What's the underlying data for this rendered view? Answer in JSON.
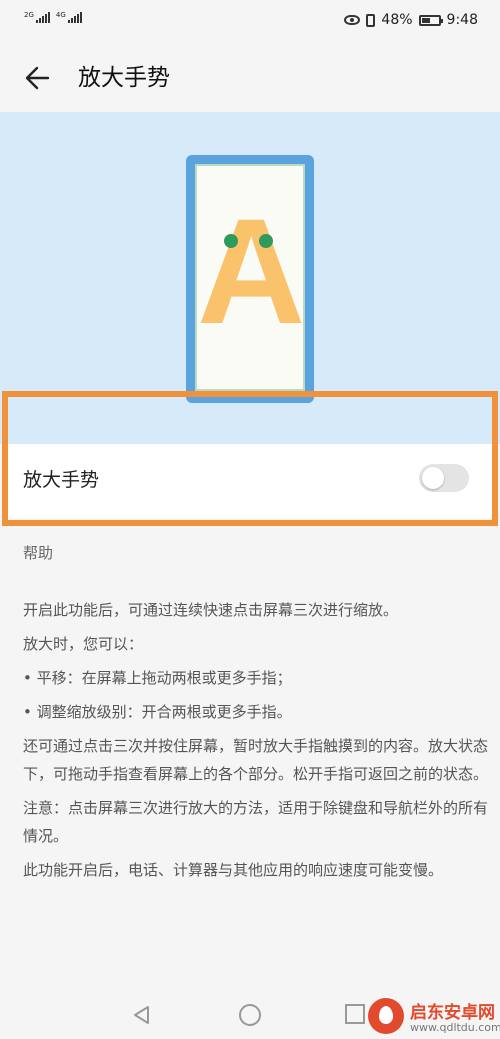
{
  "status_bar": {
    "sim1_network": "2G",
    "sim2_network": "4G",
    "battery_percent": "48%",
    "time": "9:48",
    "icons": [
      "eye-comfort-icon",
      "vibrate-icon",
      "battery-icon"
    ]
  },
  "header": {
    "title": "放大手势",
    "back_icon": "arrow-left-icon"
  },
  "illustration": {
    "letter": "A",
    "colors": {
      "background": "#d6eaf9",
      "phone_frame": "#5aa3de",
      "letter": "#f9c26b",
      "finger_dots": "#2e9b5c"
    }
  },
  "setting": {
    "label": "放大手势",
    "enabled": false
  },
  "highlight": {
    "color": "#f0923c"
  },
  "help": {
    "title": "帮助",
    "paragraphs": [
      "开启此功能后，可通过连续快速点击屏幕三次进行缩放。",
      "放大时，您可以：",
      "• 平移：在屏幕上拖动两根或更多手指；",
      "• 调整缩放级别：开合两根或更多手指。",
      "还可通过点击三次并按住屏幕，暂时放大手指触摸到的内容。放大状态下，可拖动手指查看屏幕上的各个部分。松开手指可返回之前的状态。",
      "注意：点击屏幕三次进行放大的方法，适用于除键盘和导航栏外的所有情况。",
      "此功能开启后，电话、计算器与其他应用的响应速度可能变慢。"
    ]
  },
  "nav_bar": {
    "icons": [
      "back-triangle-icon",
      "home-circle-icon",
      "recent-square-icon"
    ]
  },
  "watermark": {
    "title": "启东安卓网",
    "url": "www.qdltdu.com"
  }
}
